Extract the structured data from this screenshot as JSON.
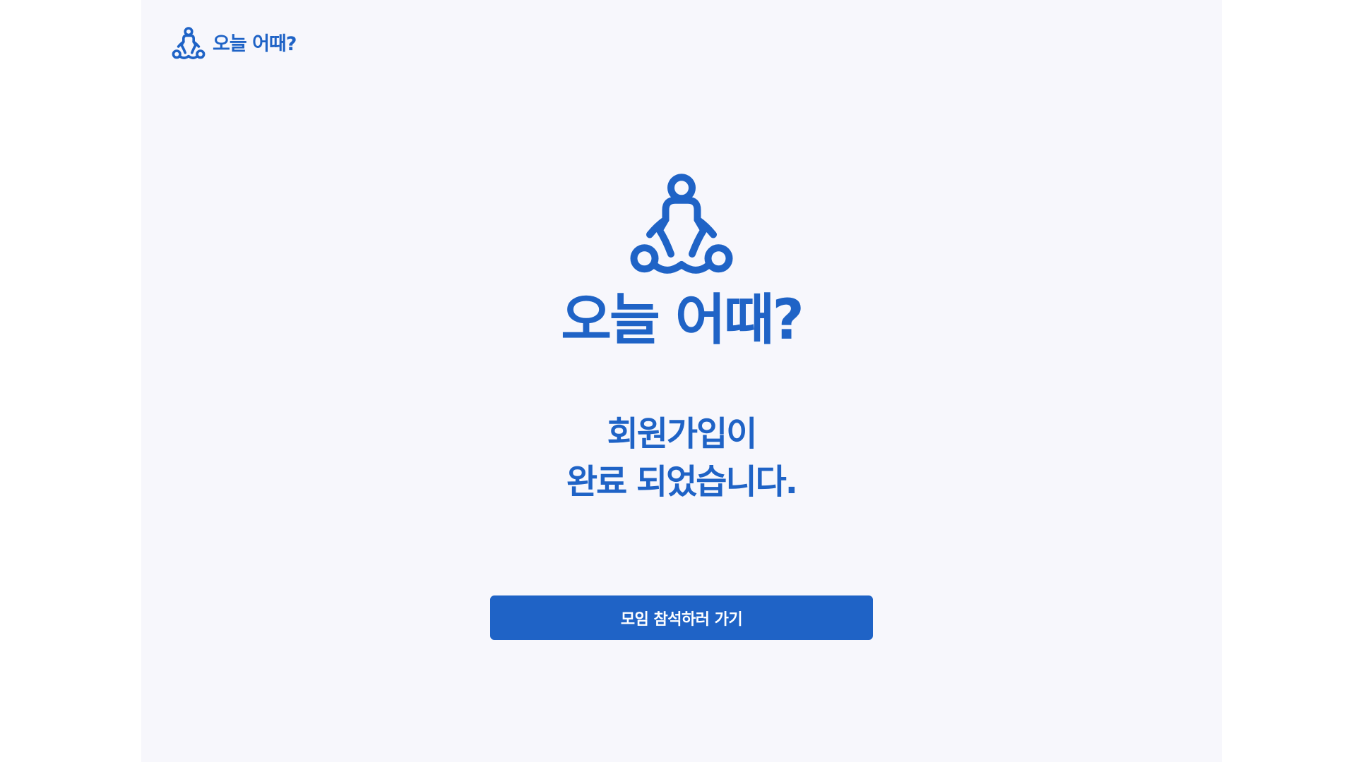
{
  "header": {
    "brand": "오늘 어때?",
    "logo_icon": "people-meeting-icon"
  },
  "hero": {
    "icon": "people-meeting-icon",
    "brand": "오늘 어때?"
  },
  "message": {
    "line1": "회원가입이",
    "line2": "완료 되었습니다."
  },
  "cta": {
    "label": "모임 참석하러 가기"
  },
  "colors": {
    "primary": "#1f63c6",
    "background": "#f7f7fc",
    "page_background": "#ffffff"
  }
}
